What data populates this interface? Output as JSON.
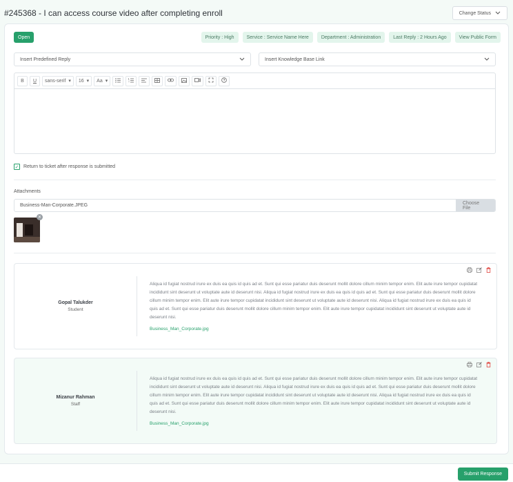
{
  "header": {
    "title": "#245368 -  I can access course video after completing enroll",
    "change_status": "Change Status"
  },
  "badges": {
    "status": "Open",
    "meta": [
      "Priority : High",
      "Service : Service Name Here",
      "Department : Administration",
      "Last Reply : 2 Hours Ago",
      "View Public Form"
    ]
  },
  "selects": {
    "predefined": "Insert Predefined Reply",
    "knowledge": "Insert Knowledge Base Link"
  },
  "toolbar": {
    "bold": "B",
    "underline": "U",
    "font": "sans-serif",
    "size": "16",
    "font_size_icon": "Aa"
  },
  "checkbox": {
    "label": "Return to ticket after response is submitted",
    "checked": true
  },
  "attachments": {
    "label": "Attachments",
    "file_name": "Business-Man-Corporate.JPEG",
    "choose": "Choose File"
  },
  "messages": [
    {
      "name": "Gopal Talukder",
      "role": "Student",
      "text": "Aliqua id fugiat nostrud irure ex duis ea quis id quis ad et. Sunt qui esse pariatur duis deserunt mollit dolore cillum minim tempor enim. Elit aute irure tempor cupidatat incididunt sint deserunt ut voluptate aute id deserunt nisi. Aliqua id fugiat nostrud irure ex duis ea quis id quis ad et. Sunt qui esse pariatur duis deserunt mollit dolore cillum minim tempor enim. Elit aute irure tempor cupidatat incididunt sint deserunt ut voluptate aute id deserunt nisi. Aliqua id fugiat nostrud irure ex duis ea quis id quis ad et. Sunt qui esse pariatur duis deserunt mollit dolore cillum minim tempor enim. Elit aute irure tempor cupidatat incididunt sint deserunt ut voluptate aute id deserunt nisi.",
      "attachment": "Business_Man_Corporate.jpg"
    },
    {
      "name": "Mizanur Rahman",
      "role": "Staff",
      "text": "Aliqua id fugiat nostrud irure ex duis ea quis id quis ad et. Sunt qui esse pariatur duis deserunt mollit dolore cillum minim tempor enim. Elit aute irure tempor cupidatat incididunt sint deserunt ut voluptate aute id deserunt nisi. Aliqua id fugiat nostrud irure ex duis ea quis id quis ad et. Sunt qui esse pariatur duis deserunt mollit dolore cillum minim tempor enim. Elit aute irure tempor cupidatat incididunt sint deserunt ut voluptate aute id deserunt nisi. Aliqua id fugiat nostrud irure ex duis ea quis id quis ad et. Sunt qui esse pariatur duis deserunt mollit dolore cillum minim tempor enim. Elit aute irure tempor cupidatat incididunt sint deserunt ut voluptate aute id deserunt nisi.",
      "attachment": "Business_Man_Corporate.jpg"
    }
  ],
  "footer": {
    "submit": "Submit Response"
  },
  "colors": {
    "accent": "#27a06b",
    "badge_bg": "#e3f5ec",
    "delete": "#e0443e"
  }
}
